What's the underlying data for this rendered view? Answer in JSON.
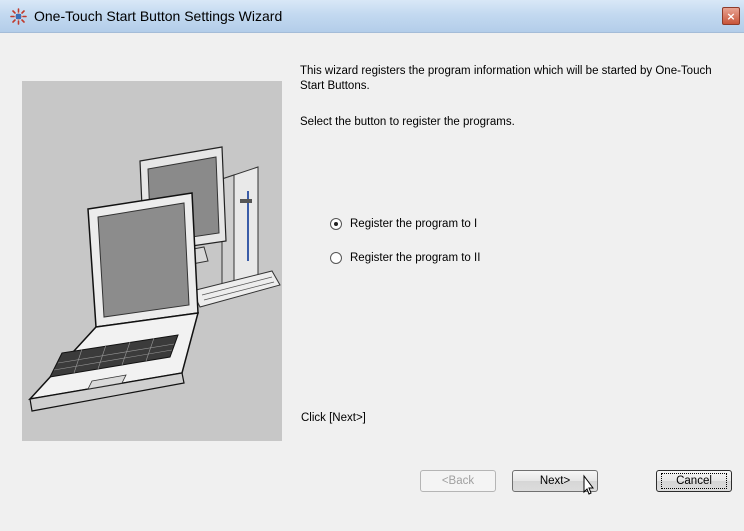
{
  "window": {
    "title": "One-Touch Start Button Settings Wizard",
    "close_label": "×"
  },
  "content": {
    "intro_text": "This wizard registers the program information which will be started by One-Touch Start Buttons.",
    "instruction_text": "Select the button to register the programs.",
    "options": [
      {
        "label": "Register the program to I",
        "selected": true
      },
      {
        "label": "Register the program to II",
        "selected": false
      }
    ],
    "hint_text": "Click [Next>]"
  },
  "buttons": {
    "back_label": "<Back",
    "next_label": "Next>",
    "cancel_label": "Cancel"
  },
  "icons": {
    "title_icon": "wizard-app-icon",
    "illustration": "computer-illustration"
  },
  "colors": {
    "titlebar": "#c3d9f0",
    "illustration_bg": "#c7c7c7",
    "dialog_bg": "#f0f0f0"
  }
}
